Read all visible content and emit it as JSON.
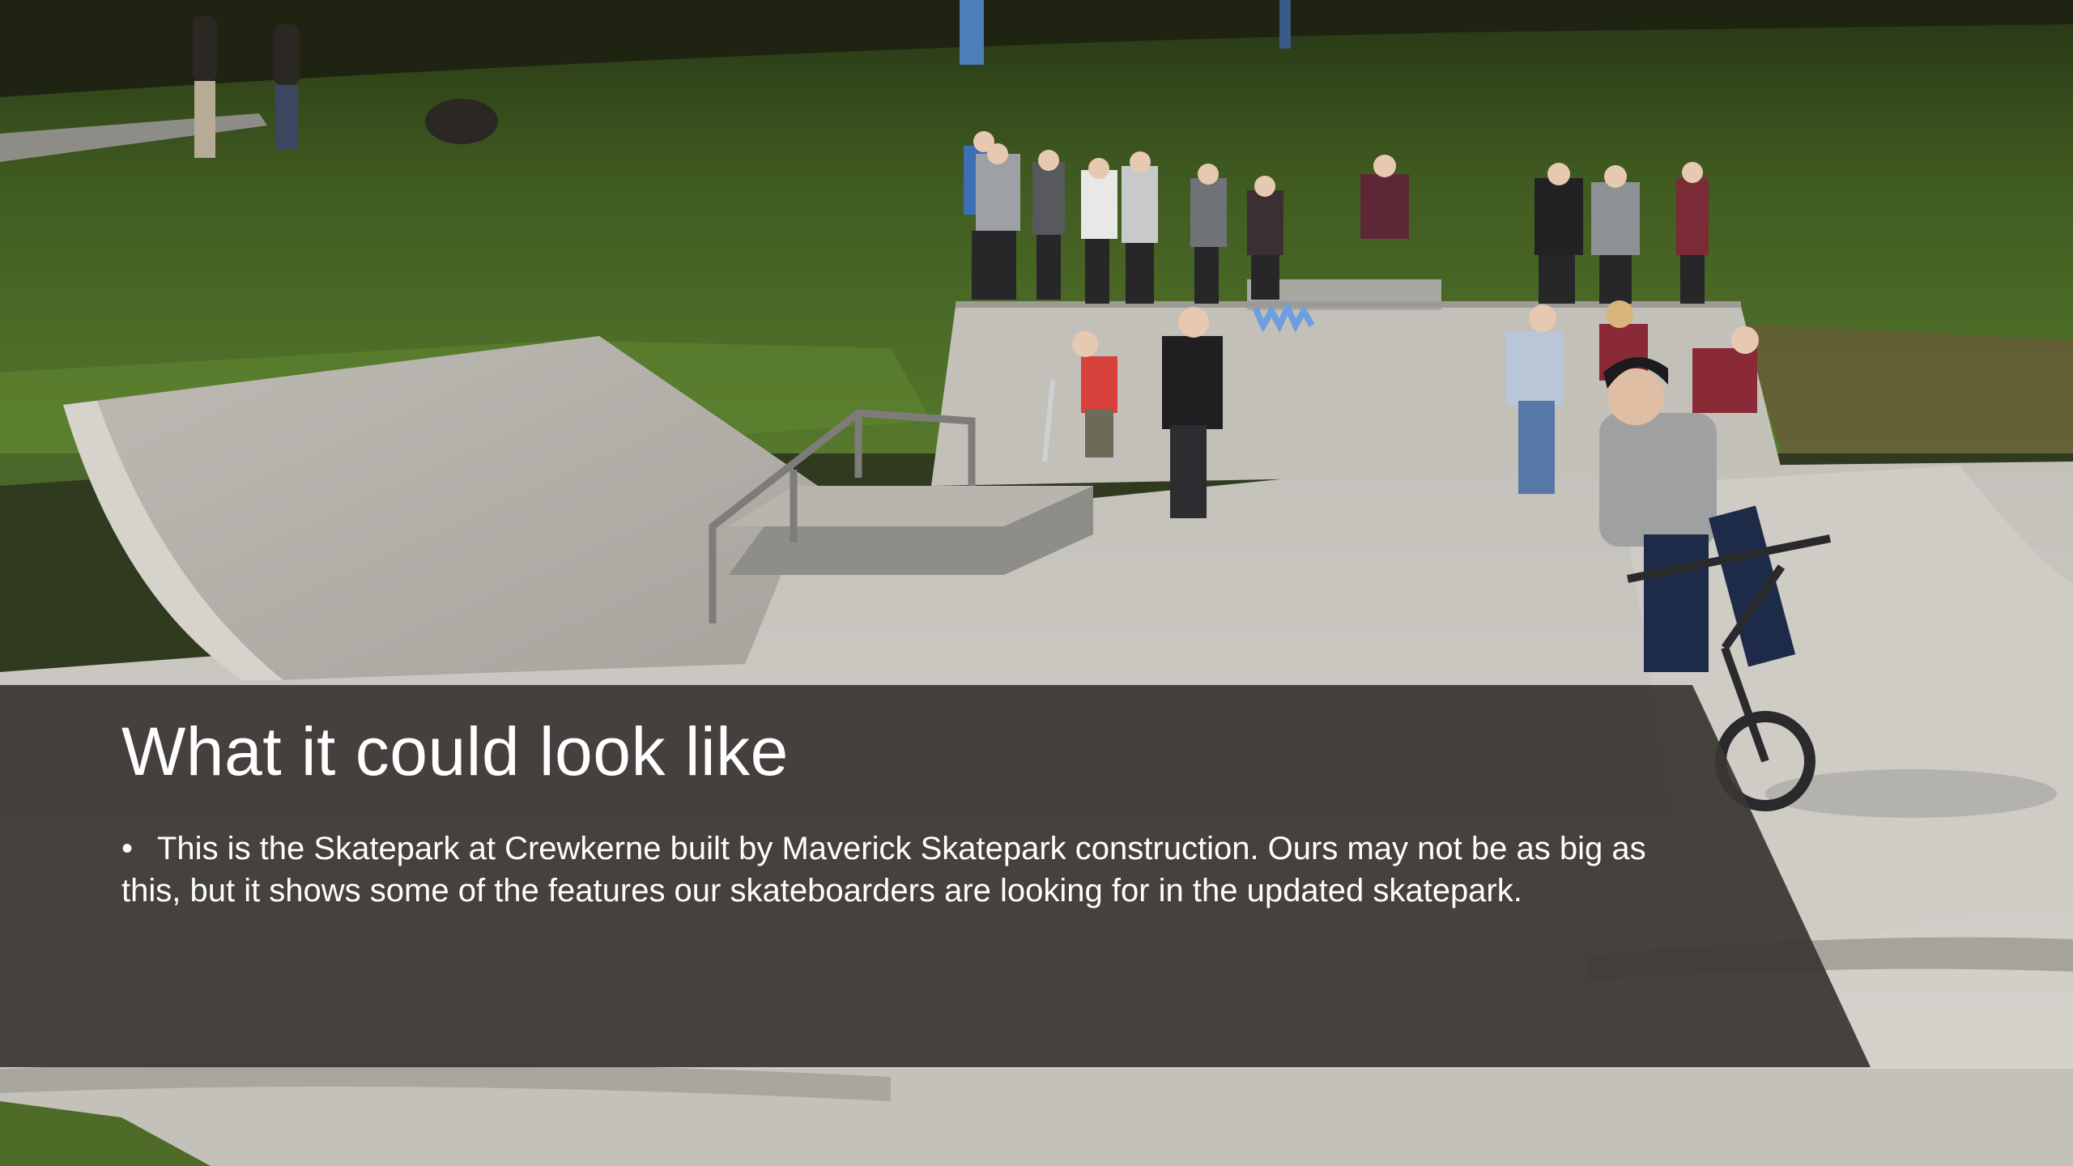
{
  "slide": {
    "title": "What it could look like",
    "bullets": [
      {
        "marker": "•",
        "text": "This is the Skatepark at Crewkerne built by Maverick Skatepark construction. Ours may not be as big as this, but it shows some of the features our skateboarders are looking for in the updated skatepark."
      }
    ]
  },
  "photo": {
    "subject": "skatepark-photo",
    "ramp_logo_icon": "wm-logo"
  },
  "colors": {
    "panel": "#3a3633",
    "text": "#ffffff",
    "grass": "#4b6a26",
    "concrete": "#c9c6c0"
  }
}
